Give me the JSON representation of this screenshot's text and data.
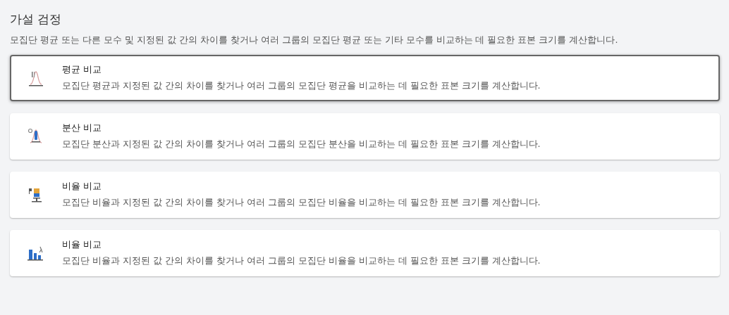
{
  "title": "가설 검정",
  "description": "모집단 평균 또는 다른 모수 및 지정된 값 간의 차이를 찾거나 여러 그룹의 모집단 평균 또는 기타 모수를 비교하는 데 필요한 표본 크기를 계산합니다.",
  "options": [
    {
      "kind": "means",
      "title": "평균 비교",
      "description": "모집단 평균과 지정된 값 간의 차이를 찾거나 여러 그룹의 모집단 평균을 비교하는 데 필요한 표본 크기를 계산합니다.",
      "selected": true
    },
    {
      "kind": "variance",
      "title": "분산 비교",
      "description": "모집단 분산과 지정된 값 간의 차이를 찾거나 여러 그룹의 모집단 분산을 비교하는 데 필요한 표본 크기를 계산합니다.",
      "selected": false
    },
    {
      "kind": "proportion",
      "title": "비율 비교",
      "description": "모집단 비율과 지정된 값 간의 차이를 찾거나 여러 그룹의 모집단 비율을 비교하는 데 필요한 표본 크기를 계산합니다.",
      "selected": false
    },
    {
      "kind": "rate",
      "title": "비율 비교",
      "description": "모집단 비율과 지정된 값 간의 차이를 찾거나 여러 그룹의 모집단 비율을 비교하는 데 필요한 표본 크기를 계산합니다.",
      "selected": false
    }
  ]
}
